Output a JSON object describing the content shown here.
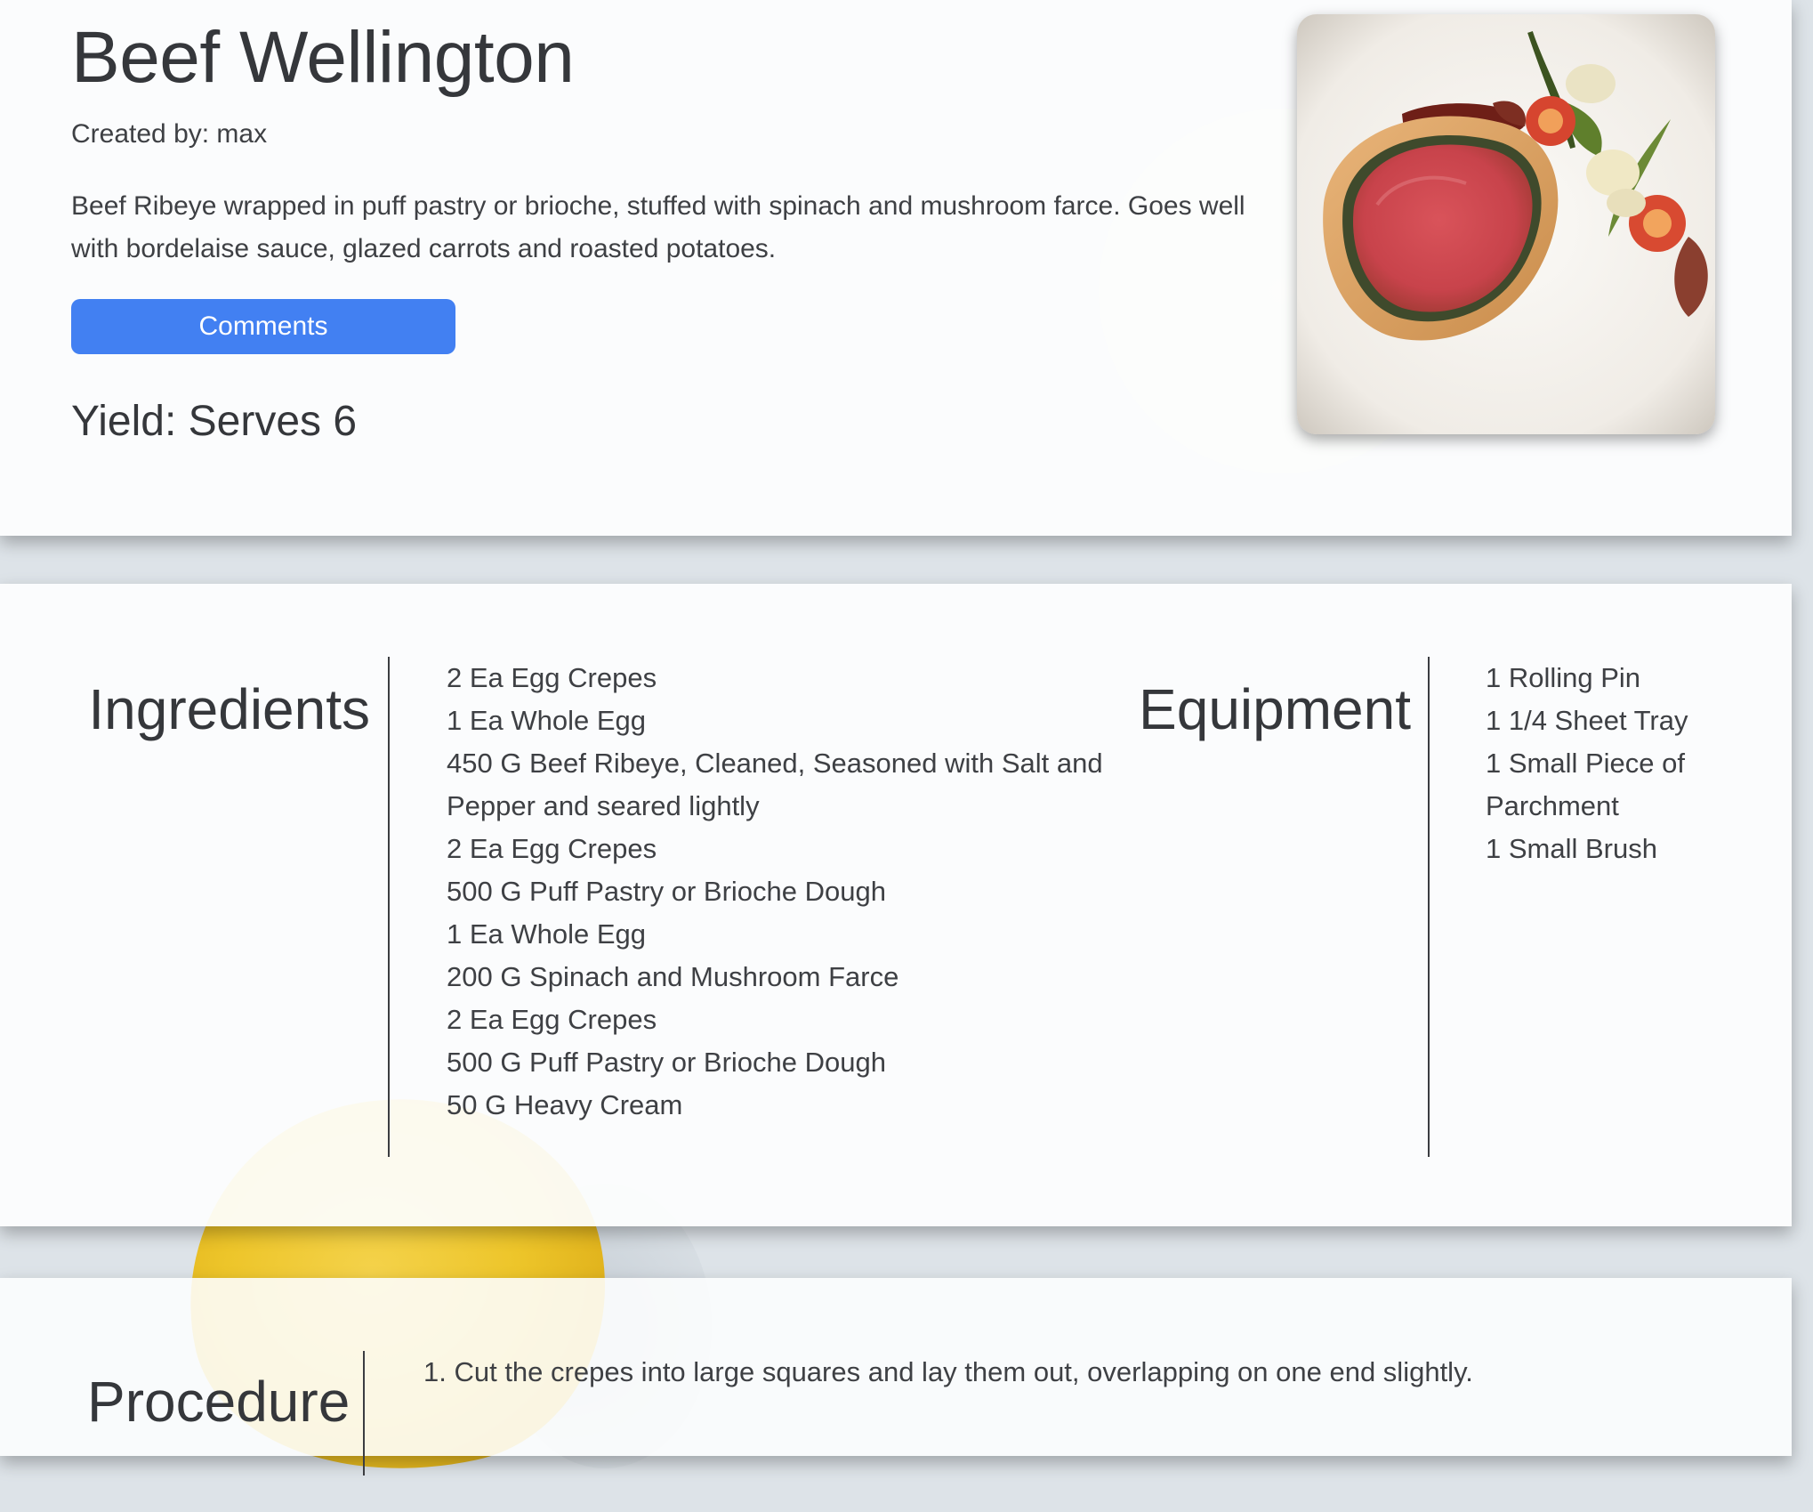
{
  "recipe": {
    "title": "Beef Wellington",
    "created_by": "Created by: max",
    "description": "Beef Ribeye wrapped in puff pastry or brioche, stuffed with spinach and mushroom farce. Goes well with bordelaise sauce, glazed carrots and roasted potatoes.",
    "comments_label": "Comments",
    "yield": "Yield: Serves 6",
    "photo_icon": "beef-wellington-photo"
  },
  "ingredients": {
    "heading": "Ingredients",
    "items": [
      "2 Ea Egg Crepes",
      "1 Ea Whole Egg",
      "450 G Beef Ribeye, Cleaned, Seasoned with Salt and Pepper and seared lightly",
      "2 Ea Egg Crepes",
      "500 G Puff Pastry or Brioche Dough",
      "1 Ea Whole Egg",
      "200 G Spinach and Mushroom Farce",
      "2 Ea Egg Crepes",
      "500 G Puff Pastry or Brioche Dough",
      "50 G Heavy Cream"
    ]
  },
  "equipment": {
    "heading": "Equipment",
    "items": [
      "1 Rolling Pin",
      "1 1/4 Sheet Tray",
      "1 Small Piece of Parchment",
      "1 Small Brush"
    ]
  },
  "procedure": {
    "heading": "Procedure",
    "steps": [
      "1. Cut the crepes into large squares and lay them out, overlapping on one end slightly."
    ]
  },
  "colors": {
    "button": "#4280f2",
    "page_background": "#dde3e8",
    "card": "#fdfefe",
    "text": "#3a3c40"
  }
}
